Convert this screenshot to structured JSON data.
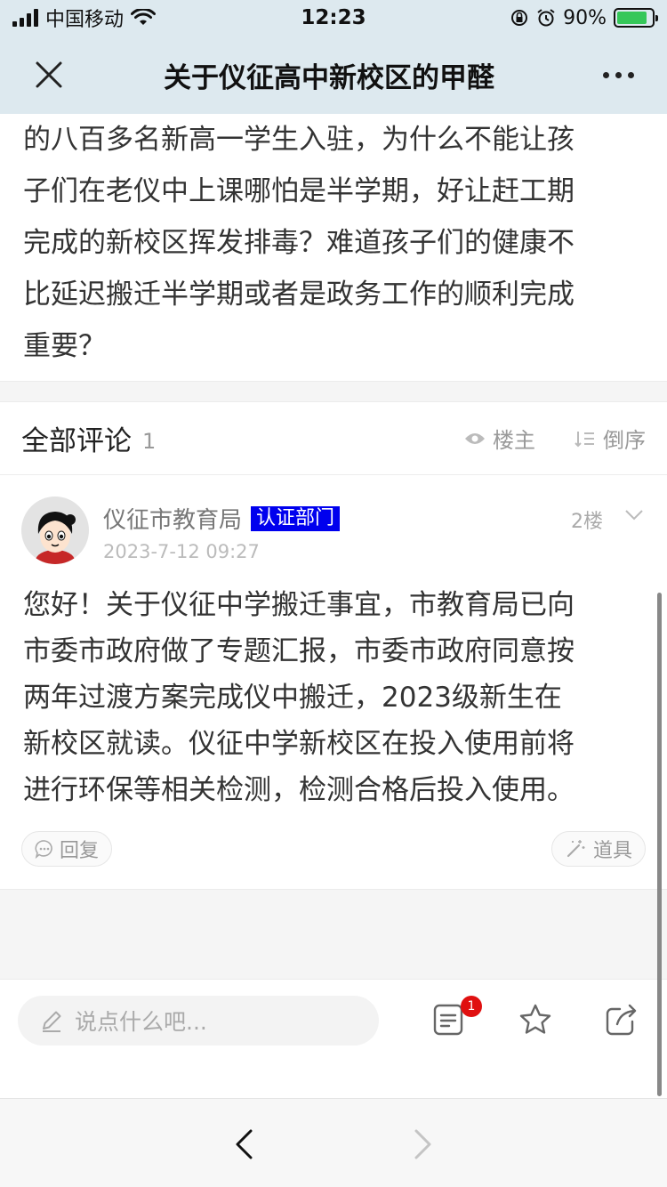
{
  "status_bar": {
    "carrier": "中国移动",
    "time": "12:23",
    "battery": "90%"
  },
  "nav": {
    "title": "关于仪征高中新校区的甲醛"
  },
  "post": {
    "lines": [
      "的八百多名新高一学生入驻，为什么不能让孩",
      "子们在老仪中上课哪怕是半学期，好让赶工期",
      "完成的新校区挥发排毒？难道孩子们的健康不",
      "比延迟搬迁半学期或者是政务工作的顺利完成",
      "重要？"
    ]
  },
  "comments_header": {
    "title": "全部评论",
    "count": "1",
    "filter_owner": "楼主",
    "sort_reverse": "倒序"
  },
  "comment": {
    "username": "仪征市教育局",
    "badge": "认证部门",
    "floor": "2楼",
    "time": "2023-7-12 09:27",
    "lines": [
      "您好！关于仪征中学搬迁事宜，市教育局已向",
      "市委市政府做了专题汇报，市委市政府同意按",
      "两年过渡方案完成仪中搬迁，2023级新生在",
      "新校区就读。仪征中学新校区在投入使用前将",
      "进行环保等相关检测，检测合格后投入使用。"
    ],
    "reply_label": "回复",
    "tools_label": "道具"
  },
  "input_bar": {
    "placeholder": "说点什么吧...",
    "notification_count": "1"
  },
  "colors": {
    "header_bg": "#dde9ef",
    "badge_bg": "#0000ee",
    "notif_red": "#e01010",
    "battery_green": "#35c759"
  }
}
